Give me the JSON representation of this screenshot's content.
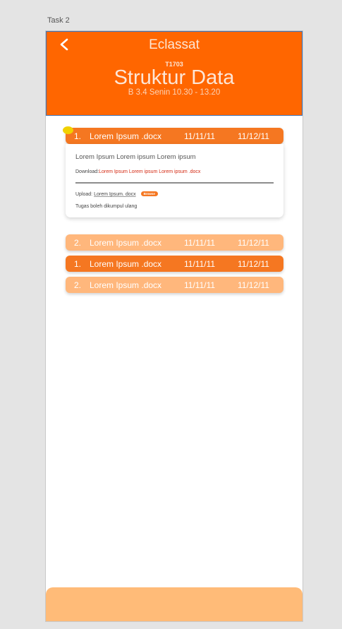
{
  "frame_label": "Task 2",
  "header": {
    "title": "Eclassat",
    "course_code": "T1703",
    "course_name": "Struktur Data",
    "schedule": "B 3.4 Senin 10.30 - 13.20"
  },
  "expanded_task": {
    "number": "1.",
    "file": "Lorem Ipsum .docx",
    "start": "11/11/11",
    "end": "11/12/11",
    "description": "Lorem Ipsum Lorem ipsum Lorem ipsum",
    "download_label": "Download:",
    "download_link": "Lorem Ipsum Lorem ipsum Lorem ipsum .docx",
    "upload_label": "Upload:",
    "upload_file": "Lorem Ipsum. docx",
    "browse_label": "Browse",
    "note": "Tugas boleh dikumpul ulang"
  },
  "tasks": [
    {
      "number": "2.",
      "file": "Lorem Ipsum .docx",
      "start": "11/11/11",
      "end": "11/12/11"
    },
    {
      "number": "1.",
      "file": "Lorem Ipsum .docx",
      "start": "11/11/11",
      "end": "11/12/11"
    },
    {
      "number": "2.",
      "file": "Lorem Ipsum .docx",
      "start": "11/11/11",
      "end": "11/12/11"
    }
  ],
  "colors": {
    "brand": "#ff6600",
    "row_dark": "#f57721",
    "row_light": "#ffb77c",
    "link": "#d42a13",
    "marker": "#f1d100"
  },
  "icons": {
    "back": "chevron-left-icon"
  }
}
